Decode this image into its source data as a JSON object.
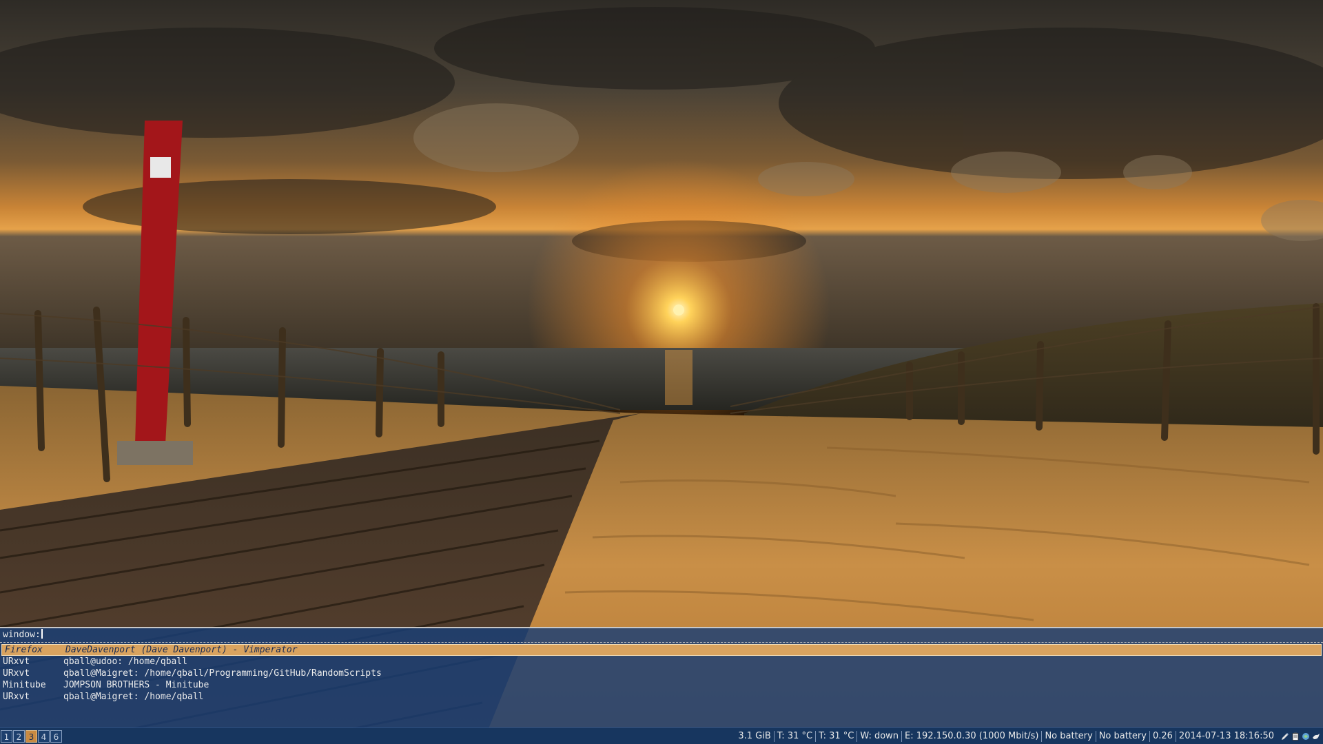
{
  "switcher": {
    "prompt": "window:",
    "entries": [
      {
        "class": "Firefox",
        "title": "DaveDavenport (Dave Davenport) - Vimperator",
        "selected": true
      },
      {
        "class": "URxvt",
        "title": "qball@udoo: /home/qball",
        "selected": false
      },
      {
        "class": "URxvt",
        "title": "qball@Maigret: /home/qball/Programming/GitHub/RandomScripts",
        "selected": false
      },
      {
        "class": "Minitube",
        "title": "JOMPSON BROTHERS - Minitube",
        "selected": false
      },
      {
        "class": "URxvt",
        "title": "qball@Maigret: /home/qball",
        "selected": false
      }
    ]
  },
  "statusbar": {
    "workspaces": [
      {
        "label": "1",
        "active": false
      },
      {
        "label": "2",
        "active": false
      },
      {
        "label": "3",
        "active": true
      },
      {
        "label": "4",
        "active": false
      },
      {
        "label": "6",
        "active": false
      }
    ],
    "memory": "3.1 GiB",
    "temp1": "T: 31 °C",
    "temp2": "T: 31 °C",
    "wireless": "W: down",
    "ethernet": "E: 192.150.0.30 (1000 Mbit/s)",
    "battery1": "No battery",
    "battery2": "No battery",
    "load": "0.26",
    "datetime": "2014-07-13 18:16:50",
    "tray_icons": [
      "pencil-icon",
      "clipboard-icon",
      "network-icon",
      "bird-icon"
    ]
  },
  "colors": {
    "accent": "#d9a35f",
    "switcher_bg": "#183e76",
    "bar_bg": "#17365f"
  }
}
